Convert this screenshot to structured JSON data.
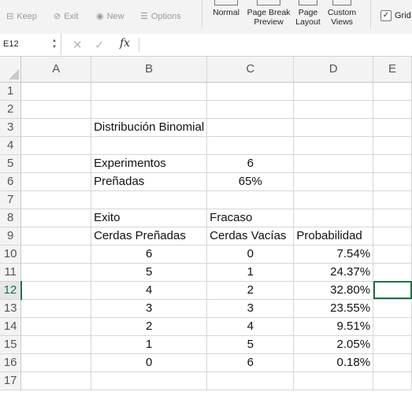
{
  "ribbon": {
    "keep_label": "Keep",
    "exit_label": "Exit",
    "new_label": "New",
    "options_label": "Options",
    "view_normal": "Normal",
    "view_pagebreak_1": "Page Break",
    "view_pagebreak_2": "Preview",
    "view_layout_1": "Page",
    "view_layout_2": "Layout",
    "view_custom_1": "Custom",
    "view_custom_2": "Views",
    "gridlines_label": "Grid",
    "gridlines_checked": "✓"
  },
  "formula_bar": {
    "name_box": "E12",
    "cancel_glyph": "✕",
    "enter_glyph": "✓",
    "fx_glyph": "fx",
    "formula": ""
  },
  "columns": [
    "A",
    "B",
    "C",
    "D",
    "E"
  ],
  "rows": [
    {
      "n": "1",
      "a": "",
      "b": "",
      "c": "",
      "d": "",
      "e": ""
    },
    {
      "n": "2",
      "a": "",
      "b": "",
      "c": "",
      "d": "",
      "e": ""
    },
    {
      "n": "3",
      "a": "",
      "b": "Distribución Binomial",
      "c": "",
      "d": "",
      "e": ""
    },
    {
      "n": "4",
      "a": "",
      "b": "",
      "c": "",
      "d": "",
      "e": ""
    },
    {
      "n": "5",
      "a": "",
      "b": "Experimentos",
      "c": "6",
      "d": "",
      "e": ""
    },
    {
      "n": "6",
      "a": "",
      "b": "Preñadas",
      "c": "65%",
      "d": "",
      "e": ""
    },
    {
      "n": "7",
      "a": "",
      "b": "",
      "c": "",
      "d": "",
      "e": ""
    },
    {
      "n": "8",
      "a": "",
      "b": "Exito",
      "c": "Fracaso",
      "d": "",
      "e": ""
    },
    {
      "n": "9",
      "a": "",
      "b": "Cerdas Preñadas",
      "c": "Cerdas Vacías",
      "d": "Probabilidad",
      "e": ""
    },
    {
      "n": "10",
      "a": "",
      "b": "6",
      "c": "0",
      "d": "7.54%",
      "e": ""
    },
    {
      "n": "11",
      "a": "",
      "b": "5",
      "c": "1",
      "d": "24.37%",
      "e": ""
    },
    {
      "n": "12",
      "a": "",
      "b": "4",
      "c": "2",
      "d": "32.80%",
      "e": ""
    },
    {
      "n": "13",
      "a": "",
      "b": "3",
      "c": "3",
      "d": "23.55%",
      "e": ""
    },
    {
      "n": "14",
      "a": "",
      "b": "2",
      "c": "4",
      "d": "9.51%",
      "e": ""
    },
    {
      "n": "15",
      "a": "",
      "b": "1",
      "c": "5",
      "d": "2.05%",
      "e": ""
    },
    {
      "n": "16",
      "a": "",
      "b": "0",
      "c": "6",
      "d": "0.18%",
      "e": ""
    },
    {
      "n": "17",
      "a": "",
      "b": "",
      "c": "",
      "d": "",
      "e": ""
    }
  ],
  "selected_cell": "E12",
  "accent_color": "#1e7145"
}
